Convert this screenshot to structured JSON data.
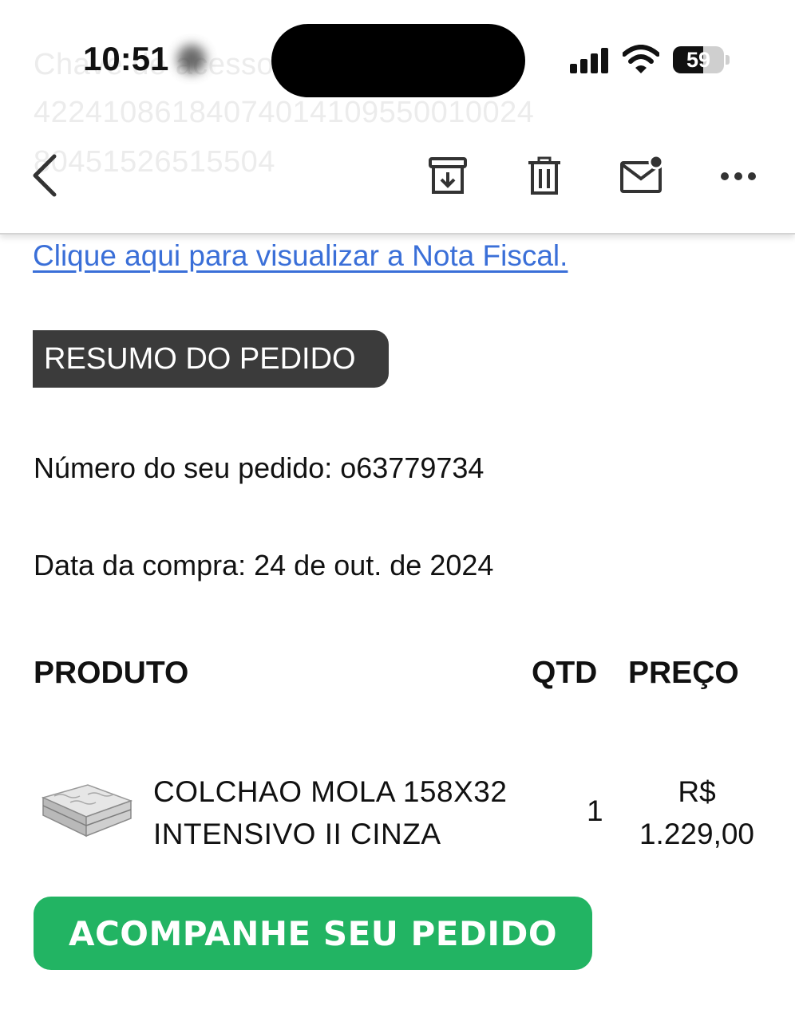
{
  "background_text": {
    "line1": "Chave de acesso",
    "line2": "42241086184074014109550010024",
    "line3": "804515265155​04"
  },
  "status_bar": {
    "time": "10:51",
    "battery": "59"
  },
  "toolbar": {
    "icons": [
      "back-chevron-icon",
      "archive-icon",
      "trash-icon",
      "mail-unread-icon",
      "more-icon"
    ]
  },
  "email": {
    "nota_fiscal_link": "Clique aqui para visualizar a Nota Fiscal.",
    "summary_badge": "RESUMO DO PEDIDO",
    "order_number": "Número do seu pedido: o63779734",
    "purchase_date": "Data da compra: 24 de out. de 2024",
    "table": {
      "headers": {
        "product": "PRODUTO",
        "qty": "QTD",
        "price": "PREÇO"
      },
      "rows": [
        {
          "name_line1": "COLCHAO MOLA 158X32",
          "name_line2": "INTENSIVO II CINZA",
          "qty": "1",
          "price_currency": "R$",
          "price_value": "1.229,00"
        }
      ]
    },
    "cta_label": "ACOMPANHE SEU PEDIDO"
  },
  "colors": {
    "link": "#3a6fd8",
    "badge_bg": "#3b3b3b",
    "cta_bg": "#22b463"
  }
}
